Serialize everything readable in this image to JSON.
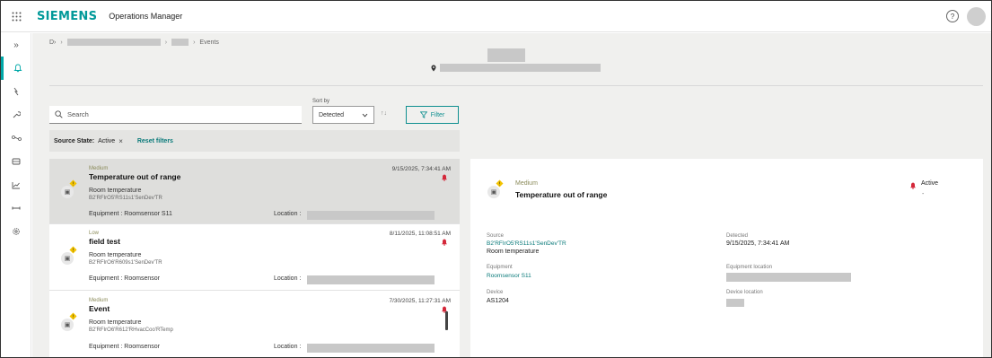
{
  "app": {
    "brand": "SIEMENS",
    "name": "Operations Manager"
  },
  "topbar": {
    "help_glyph": "?"
  },
  "breadcrumb": {
    "last": "Events"
  },
  "search": {
    "placeholder": "Search"
  },
  "sort": {
    "label": "Sort by",
    "value": "Detected"
  },
  "filter": {
    "label": "Filter"
  },
  "chips": {
    "source_state_label": "Source State:",
    "source_state_value": "Active",
    "reset": "Reset filters"
  },
  "events": [
    {
      "severity": "Medium",
      "title": "Temperature out of range",
      "sub1": "Room temperature",
      "sub2": "B2'RFIrO5'RS11s1'SenDev'TR",
      "equipment": "Equipment : Roomsensor S11",
      "location_label": "Location :",
      "time": "9/15/2025, 7:34:41 AM"
    },
    {
      "severity": "Low",
      "title": "field test",
      "sub1": "Room temperature",
      "sub2": "B2'RFIrO6'R609s1'SenDev'TR",
      "equipment": "Equipment : Roomsensor",
      "location_label": "Location :",
      "time": "8/11/2025, 11:08:51 AM"
    },
    {
      "severity": "Medium",
      "title": "Event",
      "sub1": "Room temperature",
      "sub2": "B2'RFIrO6'R612'RHvacCoo'RTemp",
      "equipment": "Equipment : Roomsensor",
      "location_label": "Location :",
      "time": "7/30/2025, 11:27:31 AM"
    }
  ],
  "detail": {
    "severity": "Medium",
    "title": "Temperature out of range",
    "status": "Active",
    "status_sub": "-",
    "source_label": "Source",
    "source_link": "B2'RFIrO5'RS11s1'SenDev'TR",
    "source_value": "Room temperature",
    "detected_label": "Detected",
    "detected_value": "9/15/2025, 7:34:41 AM",
    "equipment_label": "Equipment",
    "equipment_link": "Roomsensor S11",
    "equipment_location_label": "Equipment location",
    "device_label": "Device",
    "device_value": "AS1204",
    "device_location_label": "Device location"
  },
  "colors": {
    "brand": "#009999",
    "accent": "#0e8f8f",
    "alarm": "#d4283a",
    "warning": "#f2c200"
  }
}
